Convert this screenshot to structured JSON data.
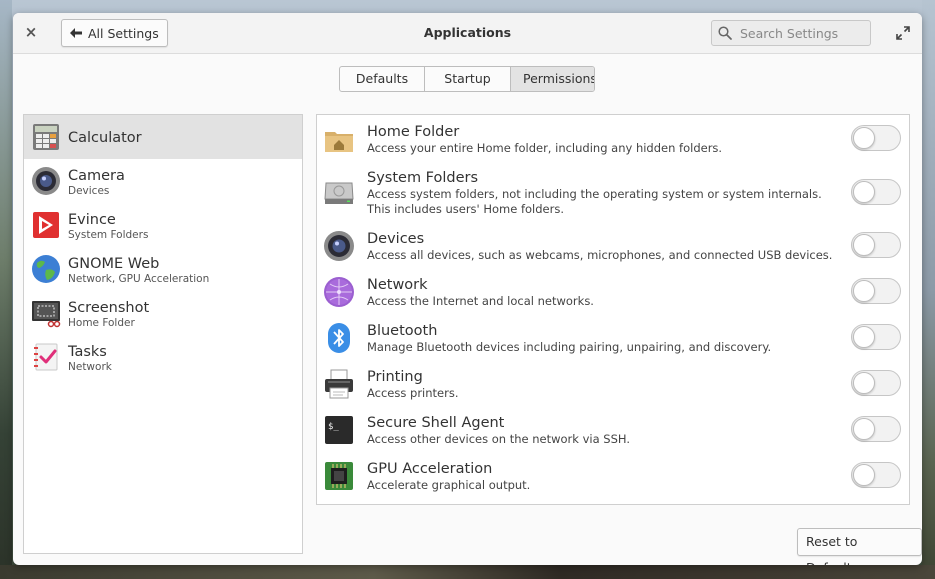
{
  "window": {
    "title": "Applications",
    "back_label": "All Settings",
    "close_glyph": "×",
    "back_glyph": "🡐"
  },
  "search": {
    "placeholder": "Search Settings"
  },
  "tabs": [
    {
      "label": "Defaults",
      "active": false
    },
    {
      "label": "Startup",
      "active": false
    },
    {
      "label": "Permissions",
      "active": true
    }
  ],
  "apps": [
    {
      "name": "Calculator",
      "sub": "",
      "icon": "calculator-icon",
      "selected": true
    },
    {
      "name": "Camera",
      "sub": "Devices",
      "icon": "camera-icon",
      "selected": false
    },
    {
      "name": "Evince",
      "sub": "System Folders",
      "icon": "evince-icon",
      "selected": false
    },
    {
      "name": "GNOME Web",
      "sub": "Network, GPU Acceleration",
      "icon": "gnome-web-icon",
      "selected": false
    },
    {
      "name": "Screenshot",
      "sub": "Home Folder",
      "icon": "screenshot-icon",
      "selected": false
    },
    {
      "name": "Tasks",
      "sub": "Network",
      "icon": "tasks-icon",
      "selected": false
    }
  ],
  "permissions": [
    {
      "title": "Home Folder",
      "desc": "Access your entire Home folder, including any hidden folders.",
      "icon": "home-folder-icon",
      "enabled": false
    },
    {
      "title": "System Folders",
      "desc": "Access system folders, not including the operating system or system internals. This includes users' Home folders.",
      "icon": "system-folders-icon",
      "enabled": false
    },
    {
      "title": "Devices",
      "desc": "Access all devices, such as webcams, microphones, and connected USB devices.",
      "icon": "devices-icon",
      "enabled": false
    },
    {
      "title": "Network",
      "desc": "Access the Internet and local networks.",
      "icon": "network-icon",
      "enabled": false
    },
    {
      "title": "Bluetooth",
      "desc": "Manage Bluetooth devices including pairing, unpairing, and discovery.",
      "icon": "bluetooth-icon",
      "enabled": false
    },
    {
      "title": "Printing",
      "desc": "Access printers.",
      "icon": "printer-icon",
      "enabled": false
    },
    {
      "title": "Secure Shell Agent",
      "desc": "Access other devices on the network via SSH.",
      "icon": "terminal-icon",
      "enabled": false
    },
    {
      "title": "GPU Acceleration",
      "desc": "Accelerate graphical output.",
      "icon": "gpu-chip-icon",
      "enabled": false
    }
  ],
  "footer": {
    "reset_label": "Reset to Defaults"
  }
}
